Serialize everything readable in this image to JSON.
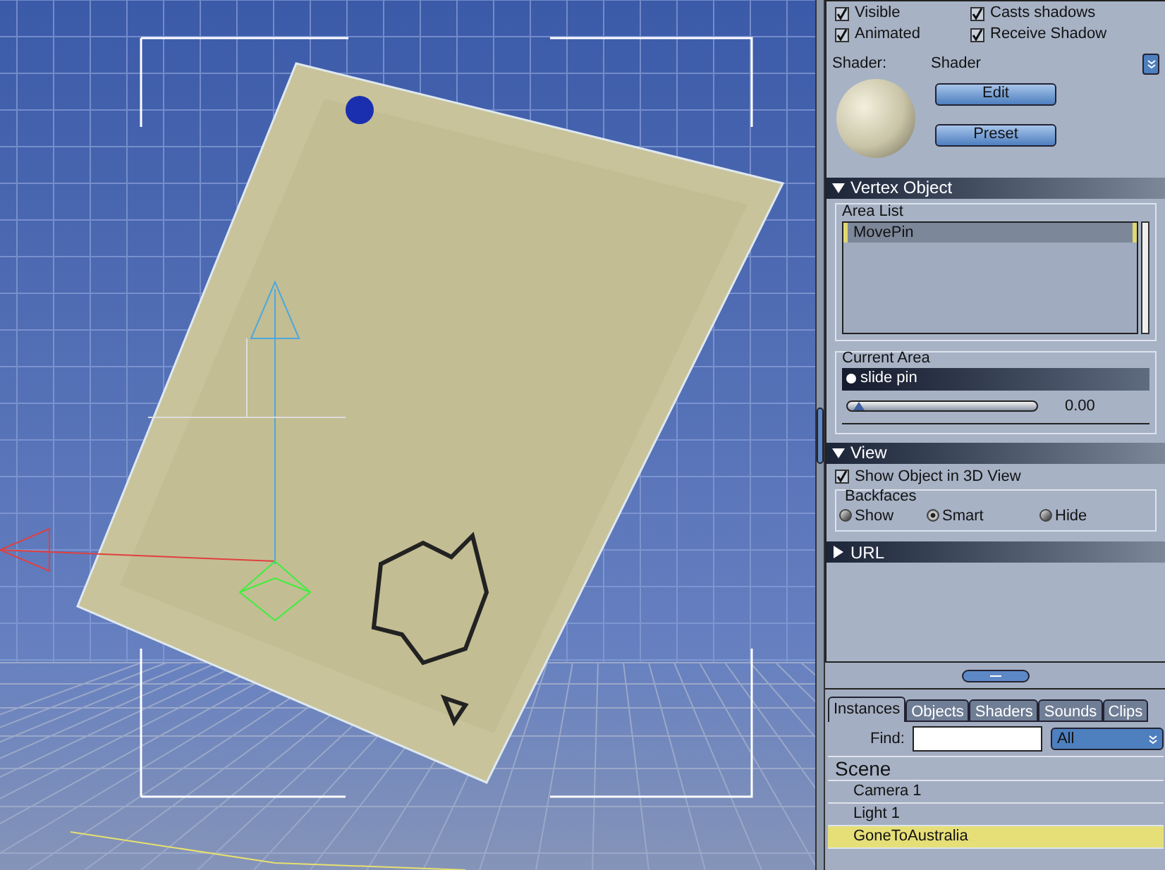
{
  "properties": {
    "checkboxes": [
      {
        "label": "Visible",
        "checked": true
      },
      {
        "label": "Casts shadows",
        "checked": true
      },
      {
        "label": "Animated",
        "checked": true
      },
      {
        "label": "Receive Shadow",
        "checked": true
      }
    ],
    "shader": {
      "label": "Shader:",
      "value": "Shader",
      "buttons": [
        "Edit",
        "Preset"
      ]
    },
    "vertex_object": {
      "title": "Vertex Object",
      "expanded": true,
      "area_list": {
        "label": "Area List",
        "items": [
          {
            "name": "MovePin",
            "selected": true
          }
        ]
      },
      "current_area": {
        "label": "Current Area",
        "area_name": "slide pin",
        "level": 0,
        "reading": "0.00"
      }
    },
    "view": {
      "title": "View",
      "expanded": true,
      "show_in_3d": {
        "label": "Show Object in 3D View",
        "checked": true
      },
      "backfaces": {
        "label": "Backfaces",
        "options": [
          {
            "label": "Show",
            "selected": false
          },
          {
            "label": "Smart",
            "selected": true
          },
          {
            "label": "Hide",
            "selected": false
          }
        ]
      }
    },
    "url": {
      "title": "URL",
      "expanded": false
    }
  },
  "browser": {
    "tabs": [
      {
        "label": "Instances",
        "selected": true
      },
      {
        "label": "Objects",
        "selected": false
      },
      {
        "label": "Shaders",
        "selected": false
      },
      {
        "label": "Sounds",
        "selected": false
      },
      {
        "label": "Clips",
        "selected": false
      }
    ],
    "find": {
      "label": "Find:"
    },
    "filter": "All",
    "group": "Scene",
    "items": [
      {
        "name": "Camera 1",
        "selected": false
      },
      {
        "name": "Light 1",
        "selected": false
      },
      {
        "name": "GoneToAustralia",
        "selected": true
      }
    ]
  }
}
